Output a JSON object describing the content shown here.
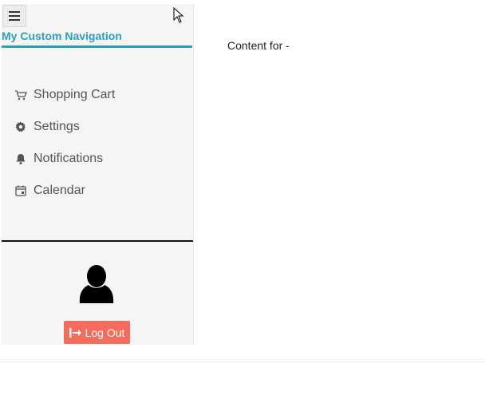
{
  "sidebar": {
    "title": "My Custom Navigation",
    "menu_icon": "hamburger-icon",
    "items": [
      {
        "label": "Shopping Cart",
        "icon": "cart-icon"
      },
      {
        "label": "Settings",
        "icon": "gear-icon"
      },
      {
        "label": "Notifications",
        "icon": "bell-icon"
      },
      {
        "label": "Calendar",
        "icon": "calendar-icon"
      }
    ],
    "user": {
      "icon": "user-avatar-icon"
    },
    "logout": {
      "label": "Log Out",
      "icon": "logout-icon"
    }
  },
  "main": {
    "content_text": "Content for -"
  },
  "colors": {
    "accent": "#2a9fbc",
    "logout_bg": "#f56b5c",
    "sidebar_bg": "#f5f5f5"
  }
}
